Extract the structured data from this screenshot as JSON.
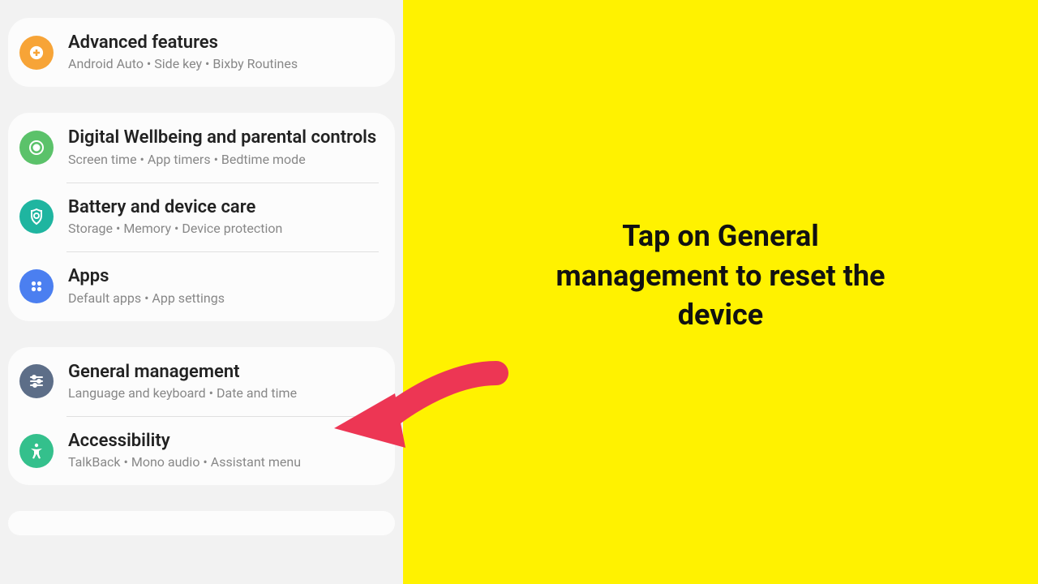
{
  "settings": {
    "groups": [
      {
        "items": [
          {
            "id": "advanced-features",
            "icon": "plus-icon",
            "iconColor": "icon-orange",
            "title": "Advanced features",
            "subtitle": "Android Auto  •  Side key  •  Bixby Routines"
          }
        ]
      },
      {
        "items": [
          {
            "id": "digital-wellbeing",
            "icon": "wellbeing-icon",
            "iconColor": "icon-green",
            "title": "Digital Wellbeing and parental controls",
            "subtitle": "Screen time  •  App timers  •  Bedtime mode"
          },
          {
            "id": "battery-device-care",
            "icon": "device-care-icon",
            "iconColor": "icon-teal",
            "title": "Battery and device care",
            "subtitle": "Storage  •  Memory  •  Device protection"
          },
          {
            "id": "apps",
            "icon": "apps-icon",
            "iconColor": "icon-blue",
            "title": "Apps",
            "subtitle": "Default apps  •  App settings"
          }
        ]
      },
      {
        "items": [
          {
            "id": "general-management",
            "icon": "sliders-icon",
            "iconColor": "icon-slate",
            "title": "General management",
            "subtitle": "Language and keyboard  •  Date and time"
          },
          {
            "id": "accessibility",
            "icon": "accessibility-icon",
            "iconColor": "icon-mint",
            "title": "Accessibility",
            "subtitle": "TalkBack  •  Mono audio  •  Assistant menu"
          }
        ]
      }
    ]
  },
  "instruction": {
    "text": "Tap on General management to reset the device"
  },
  "colors": {
    "highlight": "#fff200",
    "arrow": "#ed3654"
  }
}
